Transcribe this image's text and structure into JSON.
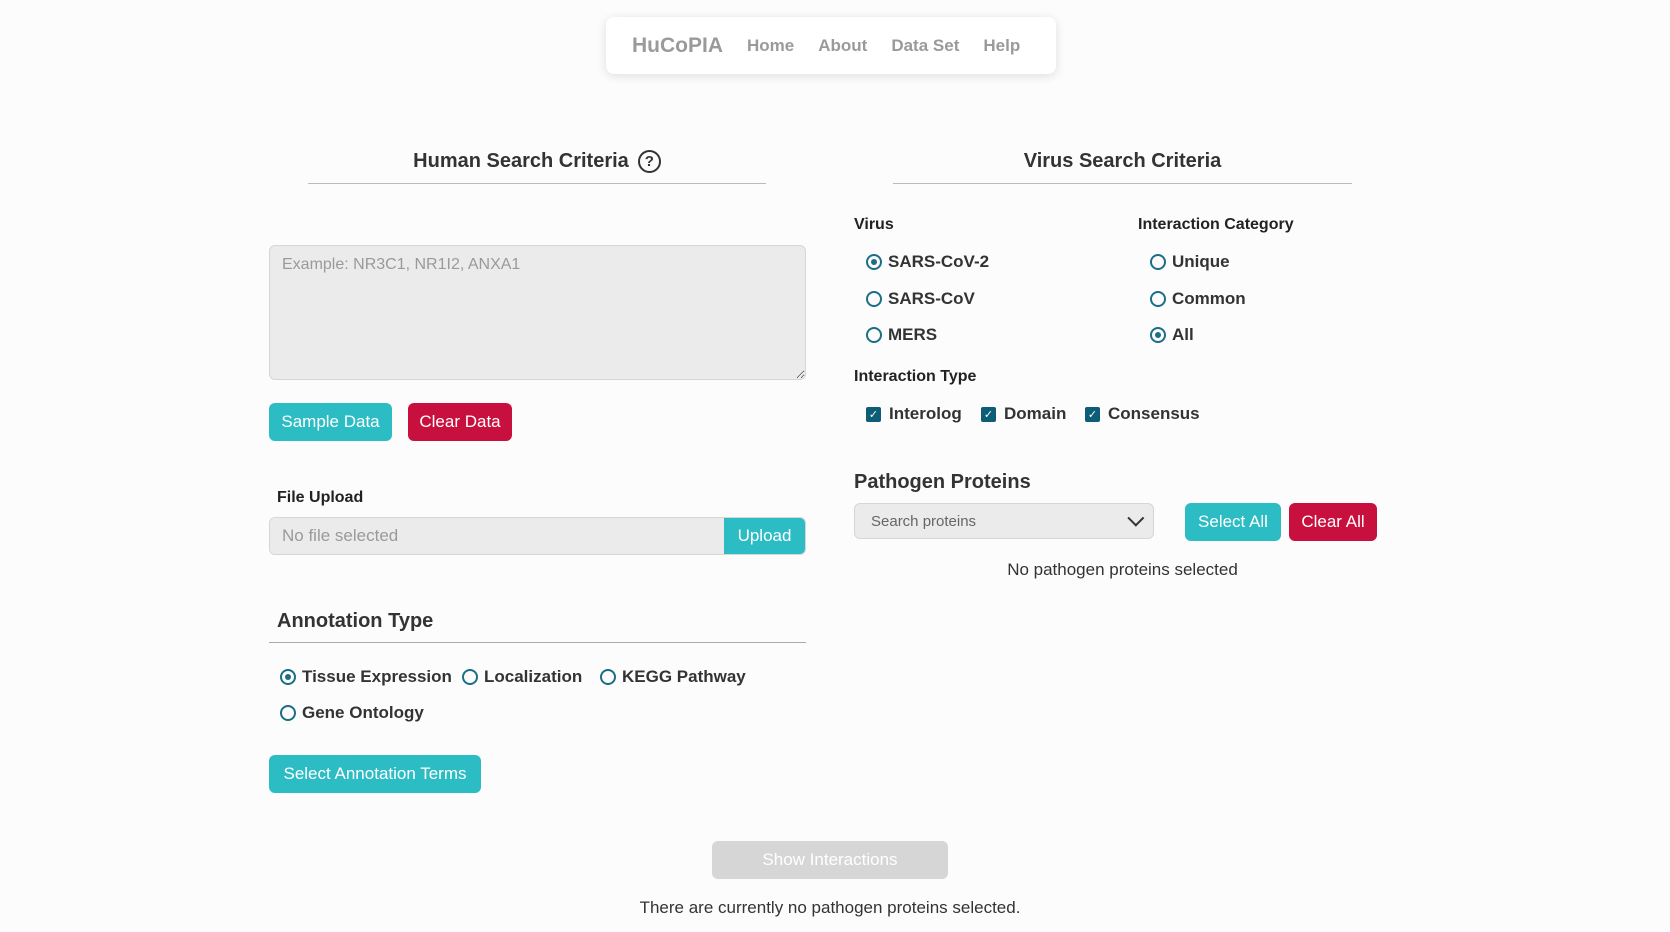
{
  "nav": {
    "brand": "HuCoPIA",
    "links": [
      "Home",
      "About",
      "Data Set",
      "Help"
    ]
  },
  "human": {
    "title": "Human Search Criteria",
    "help_icon": "question-circle-icon",
    "textarea_placeholder": "Example: NR3C1, NR1I2, ANXA1",
    "sample_button": "Sample Data",
    "clear_button": "Clear Data",
    "file_upload_label": "File Upload",
    "file_placeholder": "No file selected",
    "upload_button": "Upload",
    "annotation_heading": "Annotation Type",
    "annotation_options": [
      {
        "label": "Tissue Expression",
        "selected": true
      },
      {
        "label": "Localization",
        "selected": false
      },
      {
        "label": "KEGG Pathway",
        "selected": false
      },
      {
        "label": "Gene Ontology",
        "selected": false
      }
    ],
    "select_terms_button": "Select Annotation Terms"
  },
  "virus": {
    "title": "Virus Search Criteria",
    "virus_label": "Virus",
    "virus_options": [
      {
        "label": "SARS-CoV-2",
        "selected": true
      },
      {
        "label": "SARS-CoV",
        "selected": false
      },
      {
        "label": "MERS",
        "selected": false
      }
    ],
    "category_label": "Interaction Category",
    "category_options": [
      {
        "label": "Unique",
        "selected": false
      },
      {
        "label": "Common",
        "selected": false
      },
      {
        "label": "All",
        "selected": true
      }
    ],
    "type_label": "Interaction Type",
    "type_options": [
      {
        "label": "Interolog",
        "checked": true
      },
      {
        "label": "Domain",
        "checked": true
      },
      {
        "label": "Consensus",
        "checked": true
      }
    ],
    "pathogen_heading": "Pathogen Proteins",
    "search_placeholder": "Search proteins",
    "select_all_button": "Select All",
    "clear_all_button": "Clear All",
    "no_proteins_text": "No pathogen proteins selected"
  },
  "footer": {
    "show_button": "Show Interactions",
    "status_text": "There are currently no pathogen proteins selected."
  },
  "colors": {
    "accent": "#2cbcc4",
    "danger": "#c8103f",
    "disabled": "#d6d6d6",
    "control": "#1a6e85"
  }
}
